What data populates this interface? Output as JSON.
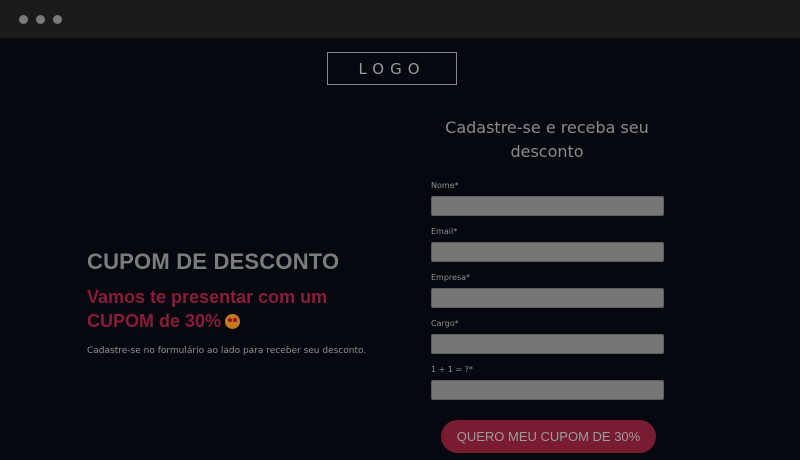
{
  "logo": {
    "text": "LOGO"
  },
  "hero": {
    "headline": "CUPOM DE DESCONTO",
    "subheadline": "Vamos te presentar com um CUPOM de 30%",
    "emoji_icon": "heart-eyes-emoji",
    "description": "Cadastre-se no formulário ao lado para receber seu desconto."
  },
  "form": {
    "title": "Cadastre-se e receba seu desconto",
    "fields": [
      {
        "label": "Nome*",
        "value": ""
      },
      {
        "label": "Email*",
        "value": ""
      },
      {
        "label": "Empresa*",
        "value": ""
      },
      {
        "label": "Cargo*",
        "value": ""
      },
      {
        "label": "1 + 1 = ?*",
        "value": ""
      }
    ],
    "submit_label": "QUERO MEU CUPOM DE 30%"
  },
  "colors": {
    "background": "#05080f",
    "accent": "#7a1c31",
    "subheadline": "#8a1c3a"
  }
}
